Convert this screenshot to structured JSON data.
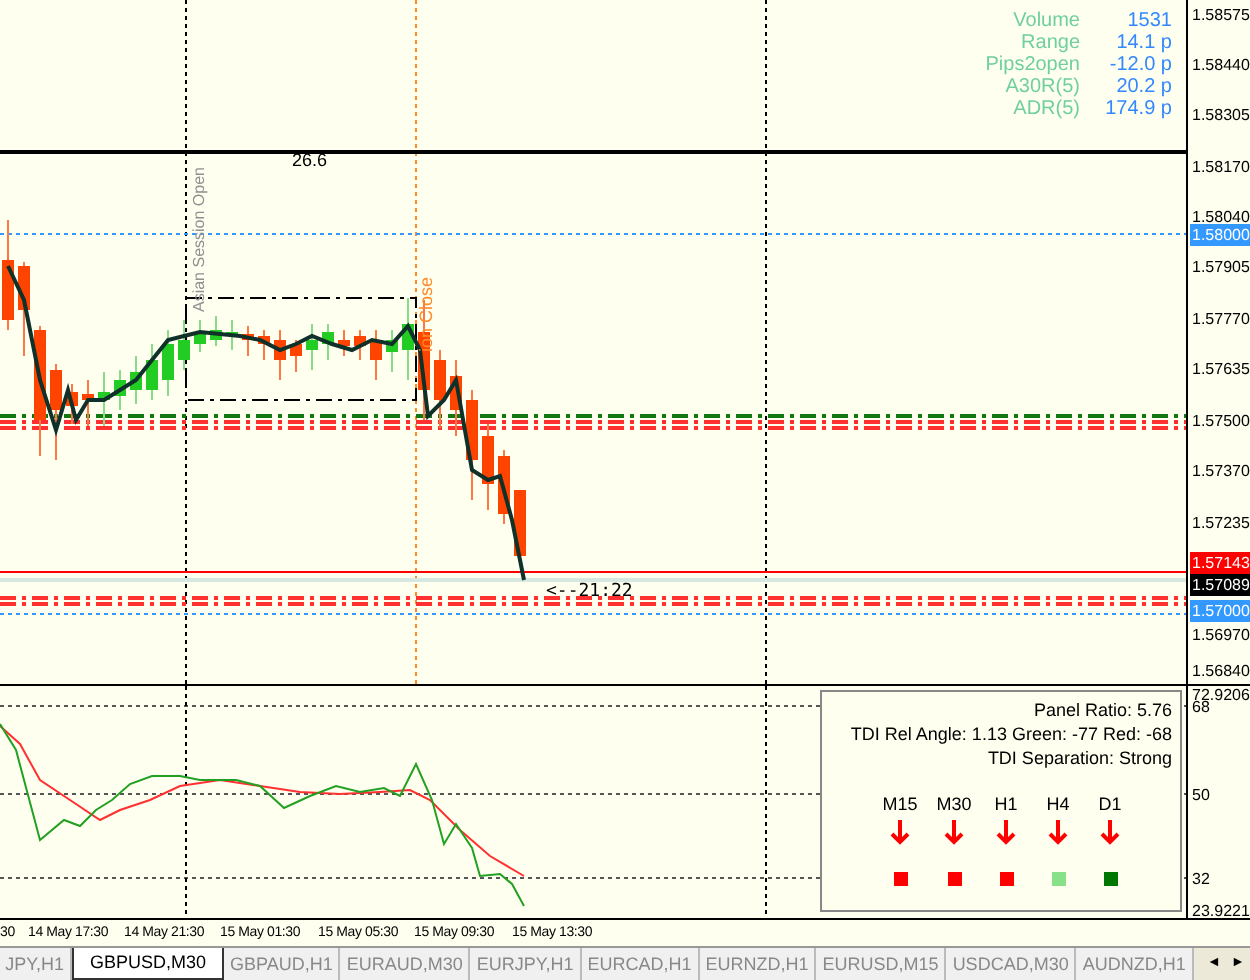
{
  "info": [
    {
      "label": "Volume",
      "value": "1531"
    },
    {
      "label": "Range",
      "value": "14.1 p"
    },
    {
      "label": "Pips2open",
      "value": "-12.0 p"
    },
    {
      "label": "A30R(5)",
      "value": "20.2 p"
    },
    {
      "label": "ADR(5)",
      "value": "174.9 p"
    }
  ],
  "chart": {
    "level_label": "26.6",
    "session_open_label": "Asian Session Open",
    "session_close_label": "ion Close",
    "timer": "<--21:22"
  },
  "price_axis": [
    {
      "label": "1.58575",
      "kind": "tick"
    },
    {
      "label": "1.58440",
      "kind": "tick"
    },
    {
      "label": "1.58305",
      "kind": "tick"
    },
    {
      "label": "1.58170",
      "kind": "tick"
    },
    {
      "label": "1.58040",
      "kind": "tick"
    },
    {
      "label": "1.58000",
      "kind": "tag",
      "color": "#3399ff"
    },
    {
      "label": "1.57905",
      "kind": "tick"
    },
    {
      "label": "1.57770",
      "kind": "tick"
    },
    {
      "label": "1.57635",
      "kind": "tick"
    },
    {
      "label": "1.57500",
      "kind": "tick"
    },
    {
      "label": "1.57370",
      "kind": "tick"
    },
    {
      "label": "1.57235",
      "kind": "tick"
    },
    {
      "label": "1.57143",
      "kind": "tag",
      "color": "#ff0000"
    },
    {
      "label": "1.57089",
      "kind": "tag",
      "color": "#000000"
    },
    {
      "label": "1.57000",
      "kind": "tag",
      "color": "#3399ff"
    },
    {
      "label": "1.56970",
      "kind": "tick"
    },
    {
      "label": "1.56840",
      "kind": "tick"
    }
  ],
  "indicator_axis": [
    "72.9206",
    "68",
    "50",
    "32",
    "23.9221"
  ],
  "panel": {
    "lines": [
      "Panel Ratio: 5.76",
      "TDI Rel Angle: 1.13 Green: -77 Red: -68",
      "TDI Separation: Strong"
    ],
    "timeframes": [
      {
        "label": "M15",
        "color": "#ff0000"
      },
      {
        "label": "M30",
        "color": "#ff0000"
      },
      {
        "label": "H1",
        "color": "#ff0000"
      },
      {
        "label": "H4",
        "color": "#88e088"
      },
      {
        "label": "D1",
        "color": "#007700"
      }
    ]
  },
  "time_axis": [
    "30",
    "14 May 17:30",
    "14 May 21:30",
    "15 May 01:30",
    "15 May 05:30",
    "15 May 09:30",
    "15 May 13:30"
  ],
  "tabs": [
    {
      "label": "JPY,H1",
      "selected": false
    },
    {
      "label": "GBPUSD,M30",
      "selected": true
    },
    {
      "label": "GBPAUD,H1",
      "selected": false
    },
    {
      "label": "EURAUD,M30",
      "selected": false
    },
    {
      "label": "EURJPY,H1",
      "selected": false
    },
    {
      "label": "EURCAD,H1",
      "selected": false
    },
    {
      "label": "EURNZD,H1",
      "selected": false
    },
    {
      "label": "EURUSD,M15",
      "selected": false
    },
    {
      "label": "USDCAD,M30",
      "selected": false
    },
    {
      "label": "AUDNZD,H1",
      "selected": false
    }
  ],
  "scroll_buttons": [
    "◄",
    "►"
  ]
}
